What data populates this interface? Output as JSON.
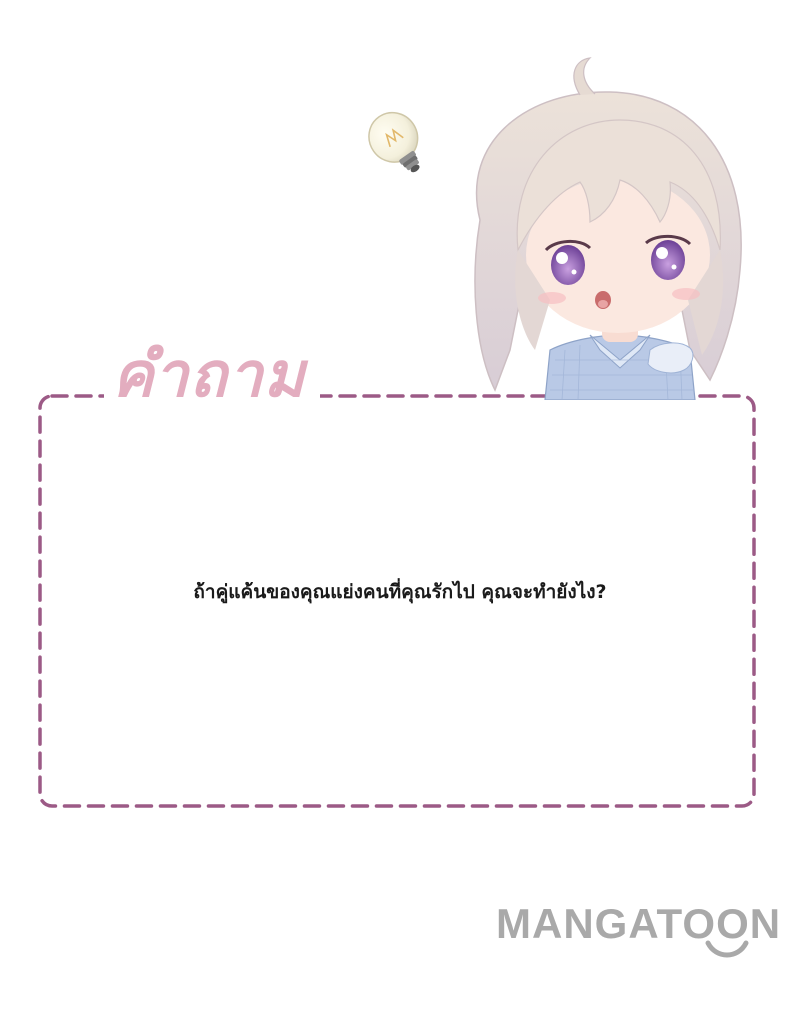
{
  "card": {
    "heading": "คำถาม",
    "question": "ถ้าคู่แค้นของคุณแย่งคนที่คุณรักไป คุณจะทำยังไง?"
  },
  "brand": {
    "name": "MANGATOON",
    "logo_icon": "smile-icon"
  },
  "illustration": {
    "character_icon": "chibi-girl-icon",
    "idea_icon": "light-bulb-icon"
  },
  "colors": {
    "frame_border": "#9c5a86",
    "heading": "#e3adbf",
    "question_text": "#1a1a1a",
    "brand": "#a9a9a9",
    "background": "#ffffff"
  }
}
